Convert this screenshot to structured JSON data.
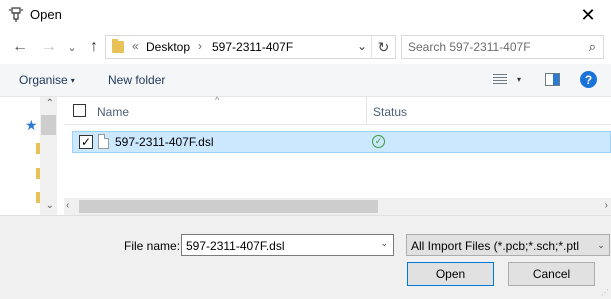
{
  "window": {
    "title": "Open",
    "close_glyph": "✕"
  },
  "navigation": {
    "back_glyph": "←",
    "forward_glyph": "→",
    "recent_glyph": "⌄",
    "up_glyph": "↑",
    "address": {
      "overflow_glyph": "«",
      "crumbs": [
        "Desktop",
        "597-2311-407F"
      ],
      "separator": "›",
      "dropdown_glyph": "⌄",
      "refresh_glyph": "↻"
    },
    "search": {
      "placeholder": "Search 597-2311-407F",
      "icon_glyph": "⌕"
    }
  },
  "toolbar": {
    "organise_label": "Organise",
    "organise_caret": "▾",
    "new_folder_label": "New folder",
    "view_caret": "▾",
    "help_glyph": "?"
  },
  "nav_pane": {
    "up_glyph": "⌃",
    "down_glyph": "⌄",
    "star_glyph": "★"
  },
  "file_list": {
    "columns": {
      "name": "Name",
      "status": "Status"
    },
    "sort_glyph": "^",
    "rows": [
      {
        "checked": true,
        "check_glyph": "✓",
        "name": "597-2311-407F.dsl",
        "status_glyph": "✓",
        "selected": true
      }
    ],
    "scroll_left_glyph": "‹",
    "scroll_right_glyph": "›"
  },
  "bottom": {
    "file_name_label": "File name:",
    "file_name_value": "597-2311-407F.dsl",
    "file_name_dropdown_glyph": "⌄",
    "file_type_value": "All Import Files (*.pcb;*.sch;*.ptl",
    "file_type_dropdown_glyph": "⌄",
    "open_label": "Open",
    "cancel_label": "Cancel",
    "grip_glyph": "⋰"
  },
  "colors": {
    "accent": "#0078d7",
    "selection": "#cce8ff",
    "success": "#3a9a3a",
    "folder": "#e8c257"
  }
}
